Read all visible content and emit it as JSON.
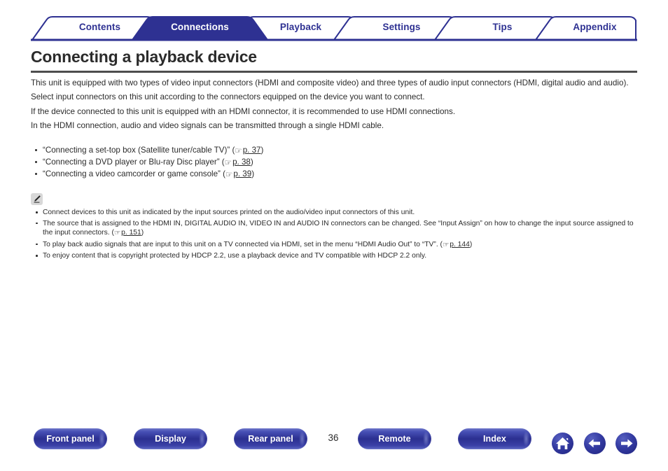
{
  "tabs": [
    {
      "label": "Contents",
      "active": false
    },
    {
      "label": "Connections",
      "active": true
    },
    {
      "label": "Playback",
      "active": false
    },
    {
      "label": "Settings",
      "active": false
    },
    {
      "label": "Tips",
      "active": false
    },
    {
      "label": "Appendix",
      "active": false
    }
  ],
  "page_title": "Connecting a playback device",
  "paragraphs": [
    "This unit is equipped with two types of video input connectors (HDMI and composite video) and three types of audio input connectors (HDMI, digital audio and audio).",
    "Select input connectors on this unit according to the connectors equipped on the device you want to connect.",
    "If the device connected to this unit is equipped with an HDMI connector, it is recommended to use HDMI connections.",
    "In the HDMI connection, audio and video signals can be transmitted through a single HDMI cable."
  ],
  "link_list": [
    {
      "text": "“Connecting a set-top box (Satellite tuner/cable TV)” (",
      "page_ref": "p. 37",
      "suffix": ")"
    },
    {
      "text": "“Connecting a DVD player or Blu-ray Disc player” (",
      "page_ref": "p. 38",
      "suffix": ")"
    },
    {
      "text": "“Connecting a video camcorder or game console” (",
      "page_ref": "p. 39",
      "suffix": ")"
    }
  ],
  "note_icon": "pencil-icon",
  "notes": [
    {
      "text": "Connect devices to this unit as indicated by the input sources printed on the audio/video input connectors of this unit.",
      "page_ref": "",
      "suffix": ""
    },
    {
      "text": "The source that is assigned to the HDMI IN, DIGITAL AUDIO IN, VIDEO IN and AUDIO IN connectors can be changed. See “Input Assign” on how to change the input source assigned to the input connectors.  (",
      "page_ref": "p. 151",
      "suffix": ")"
    },
    {
      "text": "To play back audio signals that are input to this unit on a TV connected via HDMI, set in the menu “HDMI Audio Out” to “TV”.  (",
      "page_ref": "p. 144",
      "suffix": ")"
    },
    {
      "text": "To enjoy content that is copyright protected by HDCP 2.2, use a playback device and TV compatible with HDCP 2.2 only.",
      "page_ref": "",
      "suffix": ""
    }
  ],
  "footer": {
    "buttons": [
      {
        "label": "Front panel",
        "name": "front-panel-button"
      },
      {
        "label": "Display",
        "name": "display-button"
      },
      {
        "label": "Rear panel",
        "name": "rear-panel-button"
      },
      {
        "label": "Remote",
        "name": "remote-button"
      },
      {
        "label": "Index",
        "name": "index-button"
      }
    ],
    "page_number": "36",
    "icons": [
      {
        "name": "home-icon"
      },
      {
        "name": "arrow-left-icon"
      },
      {
        "name": "arrow-right-icon"
      }
    ]
  },
  "colors": {
    "brand_blue": "#2e3192",
    "tab_active_fill": "#2e3192",
    "title_rule": "#4d4d4d",
    "text": "#2b2b2b"
  }
}
